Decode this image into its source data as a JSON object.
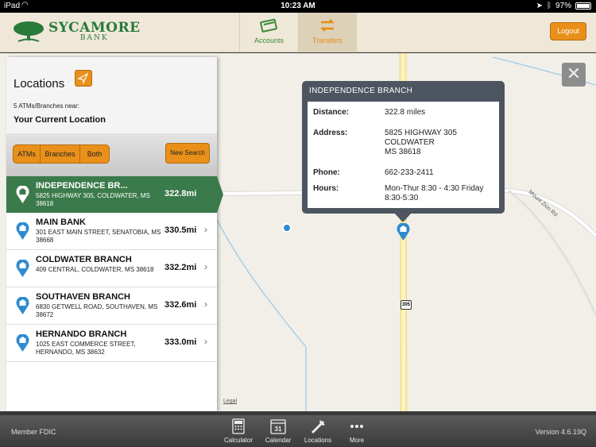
{
  "status_bar": {
    "carrier": "iPad",
    "time": "10:23 AM",
    "battery": "97%",
    "battery_level": 0.97
  },
  "header": {
    "logo_name": "SYCAMORE",
    "logo_sub": "BANK",
    "tabs": [
      {
        "label": "Accounts",
        "active": false
      },
      {
        "label": "Transfers",
        "active": true
      }
    ],
    "logout_label": "Logout"
  },
  "sidebar": {
    "title": "Locations",
    "near_count": "5 ATMs/Branches near:",
    "near_location": "Your Current Location",
    "filters": [
      "ATMs",
      "Branches",
      "Both"
    ],
    "new_search_label": "New Search",
    "items": [
      {
        "name": "INDEPENDENCE BR...",
        "address": "5825 HIGHWAY 305, COLDWATER, MS 38618",
        "distance": "322.8mi",
        "selected": true
      },
      {
        "name": "MAIN BANK",
        "address": "301 EAST MAIN STREET, SENATOBIA, MS 38668",
        "distance": "330.5mi",
        "selected": false
      },
      {
        "name": "COLDWATER BRANCH",
        "address": "409 CENTRAL, COLDWATER, MS 38618",
        "distance": "332.2mi",
        "selected": false
      },
      {
        "name": "SOUTHAVEN BRANCH",
        "address": "6830 GETWELL ROAD, SOUTHAVEN, MS 38672",
        "distance": "332.6mi",
        "selected": false
      },
      {
        "name": "HERNANDO BRANCH",
        "address": "1025 EAST COMMERCE STREET, HERNANDO, MS 38632",
        "distance": "333.0mi",
        "selected": false
      }
    ]
  },
  "popup": {
    "title": "INDEPENDENCE BRANCH",
    "distance_label": "Distance:",
    "distance": "322.8 miles",
    "address_label": "Address:",
    "address_line1": "5825 HIGHWAY 305",
    "address_line2": "COLDWATER",
    "address_line3": "MS  38618",
    "phone_label": "Phone:",
    "phone": "662-233-2411",
    "hours_label": "Hours:",
    "hours": "Mon-Thur 8:30 - 4:30    Friday 8:30-5:30"
  },
  "map": {
    "road_label": "Mount Zion Rd",
    "highway_shield": "305",
    "legal_label": "Legal",
    "close_label": "✕"
  },
  "bottom_bar": {
    "footer_left": "Member FDIC",
    "version": "Version 4.6.19Q",
    "tools": [
      "Calculator",
      "Calendar",
      "Locations",
      "More"
    ],
    "calendar_day": "31"
  },
  "colors": {
    "accent_orange": "#e9901b",
    "brand_green": "#2a7a3b",
    "selected_green": "#3b7a4a",
    "popup_dark": "#4d5660"
  }
}
